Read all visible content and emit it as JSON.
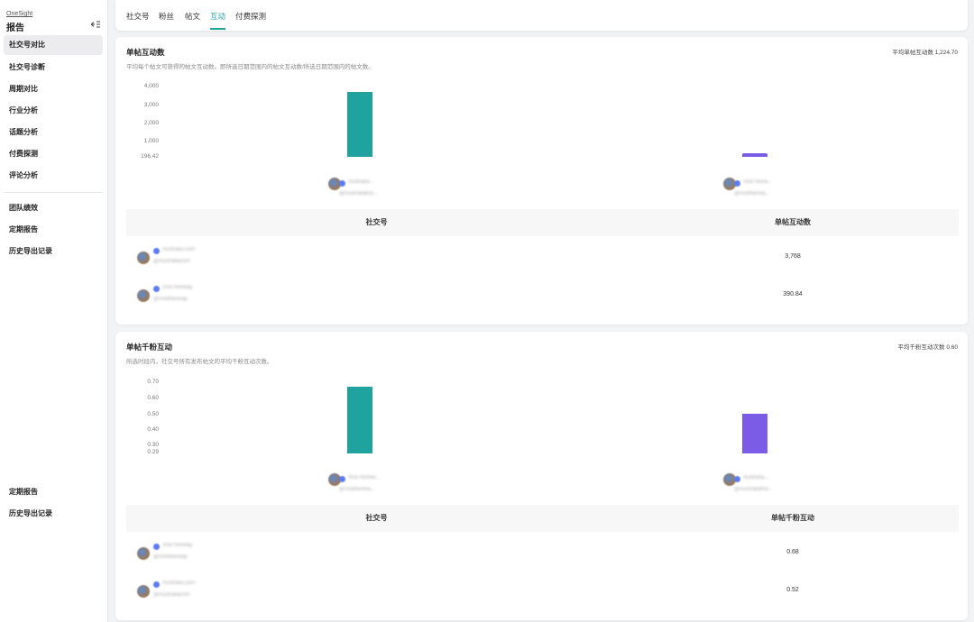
{
  "sidebar": {
    "brand": "OneSight",
    "title": "报告",
    "items_top": [
      {
        "label": "社交号对比",
        "active": true
      },
      {
        "label": "社交号诊断"
      },
      {
        "label": "周期对比"
      },
      {
        "label": "行业分析"
      },
      {
        "label": "话题分析"
      },
      {
        "label": "付费探测"
      },
      {
        "label": "评论分析"
      }
    ],
    "items_mid": [
      {
        "label": "团队绩效"
      },
      {
        "label": "定期报告"
      },
      {
        "label": "历史导出记录"
      }
    ],
    "items_bottom": [
      {
        "label": "定期报告"
      },
      {
        "label": "历史导出记录"
      }
    ]
  },
  "tabs": [
    {
      "label": "社交号"
    },
    {
      "label": "粉丝"
    },
    {
      "label": "帖文"
    },
    {
      "label": "互动",
      "active": true
    },
    {
      "label": "付费探测"
    }
  ],
  "card1": {
    "title": "单帖互动数",
    "description": "平均每个帖文可获得的帖文互动数。即所选日期范围内的帖文互动数/所选日期范围内的帖文数。",
    "avg_label": "平均单帖互动数 1,224.70",
    "y_ticks": [
      "4,000",
      "3,000",
      "2,000",
      "1,000",
      "196.42"
    ],
    "accounts": [
      {
        "name": "Australia...",
        "handle": "@Australiahut..."
      },
      {
        "name": "Visit Nova...",
        "handle": "@VisitNorwa..."
      }
    ],
    "table": {
      "col1": "社交号",
      "col2": "单帖互动数",
      "rows": [
        {
          "name": "Australia.com",
          "handle": "@Australiacom",
          "value": "3,768"
        },
        {
          "name": "Visit Norway",
          "handle": "@VisitNorway",
          "value": "390.84"
        }
      ]
    }
  },
  "card2": {
    "title": "单帖千粉互动",
    "description": "所选时段内，社交号所有发布帖文的平均千粉互动次数。",
    "avg_label": "平均千粉互动次数 0.60",
    "y_ticks": [
      "0.70",
      "0.60",
      "0.50",
      "0.40",
      "0.30",
      "0.29"
    ],
    "accounts": [
      {
        "name": "Visit Norwa...",
        "handle": "@VisitNorwa..."
      },
      {
        "name": "Australia...",
        "handle": "@Australiahut..."
      }
    ],
    "table": {
      "col1": "社交号",
      "col2": "单帖千粉互动",
      "rows": [
        {
          "name": "Visit Norway",
          "handle": "@VisitNorway",
          "value": "0.68"
        },
        {
          "name": "Australia.com",
          "handle": "@Australiacom",
          "value": "0.52"
        }
      ]
    }
  },
  "chart_data": [
    {
      "type": "bar",
      "title": "单帖互动数",
      "categories": [
        "Australia...",
        "Visit Nova..."
      ],
      "values": [
        3768,
        390.84
      ],
      "ylim": [
        196.42,
        4000
      ],
      "colors": [
        "#20a39e",
        "#7b5ce6"
      ]
    },
    {
      "type": "bar",
      "title": "单帖千粉互动",
      "categories": [
        "Visit Norwa...",
        "Australia..."
      ],
      "values": [
        0.68,
        0.52
      ],
      "ylim": [
        0.29,
        0.7
      ],
      "colors": [
        "#20a39e",
        "#7b5ce6"
      ]
    }
  ],
  "colors": {
    "accent": "#20a39e",
    "series1": "#20a39e",
    "series2": "#7b5ce6"
  }
}
